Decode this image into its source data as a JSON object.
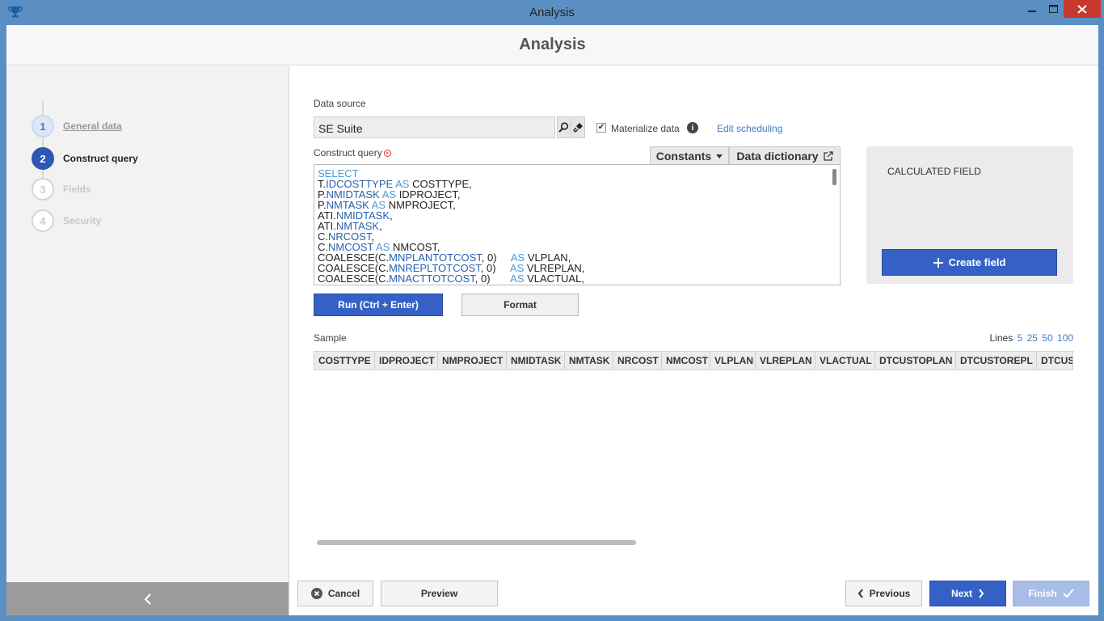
{
  "window": {
    "title": "Analysis",
    "app_icon": "trophy-icon"
  },
  "header": {
    "title": "Analysis"
  },
  "steps": [
    {
      "number": "1",
      "label": "General data",
      "state": "done"
    },
    {
      "number": "2",
      "label": "Construct query",
      "state": "active"
    },
    {
      "number": "3",
      "label": "Fields",
      "state": "pending"
    },
    {
      "number": "4",
      "label": "Security",
      "state": "pending"
    }
  ],
  "datasource": {
    "label": "Data source",
    "value": "SE Suite",
    "materialize_label": "Materialize data",
    "materialize_checked": true,
    "edit_scheduling": "Edit scheduling"
  },
  "query": {
    "label": "Construct query",
    "constants_label": "Constants",
    "dictionary_label": "Data dictionary",
    "sql_lines": [
      [
        {
          "t": "SELECT",
          "c": "kw"
        }
      ],
      [
        {
          "t": "T."
        },
        {
          "t": "IDCOSTTYPE",
          "c": "fld"
        },
        {
          "t": " "
        },
        {
          "t": "AS",
          "c": "kw"
        },
        {
          "t": " COSTTYPE,"
        }
      ],
      [
        {
          "t": "P."
        },
        {
          "t": "NMIDTASK",
          "c": "fld"
        },
        {
          "t": " "
        },
        {
          "t": "AS",
          "c": "kw"
        },
        {
          "t": " IDPROJECT,"
        }
      ],
      [
        {
          "t": "P."
        },
        {
          "t": "NMTASK",
          "c": "fld"
        },
        {
          "t": " "
        },
        {
          "t": "AS",
          "c": "kw"
        },
        {
          "t": " NMPROJECT,"
        }
      ],
      [
        {
          "t": "ATI."
        },
        {
          "t": "NMIDTASK",
          "c": "fld"
        },
        {
          "t": ","
        }
      ],
      [
        {
          "t": "ATI."
        },
        {
          "t": "NMTASK",
          "c": "fld"
        },
        {
          "t": ","
        }
      ],
      [
        {
          "t": "C."
        },
        {
          "t": "NRCOST",
          "c": "fld"
        },
        {
          "t": ","
        }
      ],
      [
        {
          "t": "C."
        },
        {
          "t": "NMCOST",
          "c": "fld"
        },
        {
          "t": " "
        },
        {
          "t": "AS",
          "c": "kw"
        },
        {
          "t": " NMCOST,"
        }
      ],
      [
        {
          "t": "COALESCE(C."
        },
        {
          "t": "MNPLANTOTCOST",
          "c": "fld"
        },
        {
          "t": ", 0)     "
        },
        {
          "t": "AS",
          "c": "kw"
        },
        {
          "t": " VLPLAN,"
        }
      ],
      [
        {
          "t": "COALESCE(C."
        },
        {
          "t": "MNREPLTOTCOST",
          "c": "fld"
        },
        {
          "t": ", 0)     "
        },
        {
          "t": "AS",
          "c": "kw"
        },
        {
          "t": " VLREPLAN,"
        }
      ],
      [
        {
          "t": "COALESCE(C."
        },
        {
          "t": "MNACTTOTCOST",
          "c": "fld"
        },
        {
          "t": ", 0)       "
        },
        {
          "t": "AS",
          "c": "kw"
        },
        {
          "t": " VLACTUAL,"
        }
      ]
    ]
  },
  "calculated_field": {
    "title": "CALCULATED FIELD",
    "create_label": "Create field"
  },
  "actions": {
    "run_label": "Run (Ctrl + Enter)",
    "format_label": "Format"
  },
  "sample": {
    "label": "Sample",
    "lines_label": "Lines",
    "line_options": [
      "5",
      "25",
      "50",
      "100"
    ],
    "columns": [
      "COSTTYPE",
      "IDPROJECT",
      "NMPROJECT",
      "NMIDTASK",
      "NMTASK",
      "NRCOST",
      "NMCOST",
      "VLPLAN",
      "VLREPLAN",
      "VLACTUAL",
      "DTCUSTOPLAN",
      "DTCUSTOREPL",
      "DTCUS"
    ]
  },
  "footer": {
    "cancel_label": "Cancel",
    "preview_label": "Preview",
    "previous_label": "Previous",
    "next_label": "Next",
    "finish_label": "Finish"
  },
  "colors": {
    "titlebar": "#5b8fc4",
    "primary": "#3561c6",
    "link": "#3d7fc5",
    "close": "#c7392d"
  }
}
